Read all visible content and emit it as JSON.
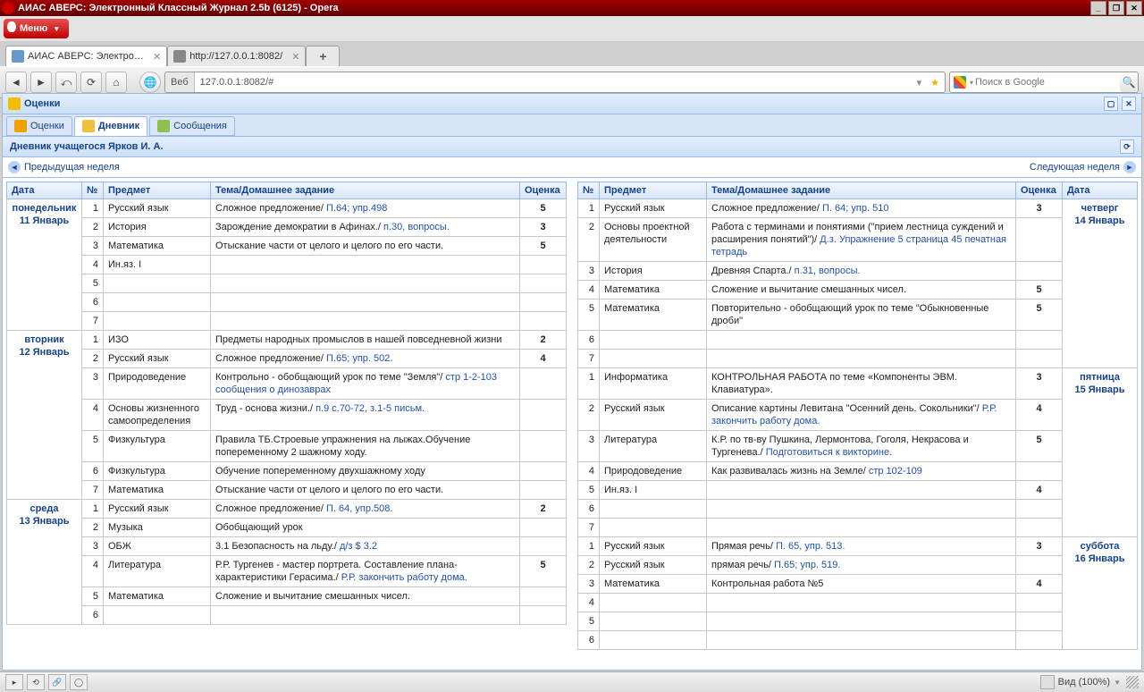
{
  "window": {
    "title": "АИАС АВЕРС: Электронный Классный Журнал 2.5b (6125) - Opera"
  },
  "opera": {
    "menu": "Меню"
  },
  "tabs": [
    {
      "label": "АИАС АВЕРС: Электрон...",
      "active": true
    },
    {
      "label": "http://127.0.0.1:8082/",
      "active": false
    }
  ],
  "nav": {
    "web_label": "Веб",
    "url": "127.0.0.1:8082/#",
    "search_placeholder": "Поиск в Google"
  },
  "panel": {
    "title": "Оценки"
  },
  "app_tabs": {
    "grades": "Оценки",
    "diary": "Дневник",
    "messages": "Сообщения"
  },
  "sub_title": "Дневник учащегося Ярков И. А.",
  "weeknav": {
    "prev": "Предыдущая неделя",
    "next": "Следующая неделя"
  },
  "headers": {
    "date": "Дата",
    "num": "№",
    "subject": "Предмет",
    "hw": "Тема/Домашнее задание",
    "mark": "Оценка"
  },
  "status": {
    "view": "Вид (100%)"
  },
  "days_left": [
    {
      "name": "понедельник",
      "date": "11 Январь",
      "rows": [
        {
          "n": 1,
          "subj": "Русский язык",
          "topic": "Сложное предложение/",
          "hw": " П.64; упр.498",
          "mark": "5"
        },
        {
          "n": 2,
          "subj": "История",
          "topic": "Зарождение демократии в Афинах./",
          "hw": " п.30, вопросы.",
          "mark": "3"
        },
        {
          "n": 3,
          "subj": "Математика",
          "topic": "Отыскание части от целого и целого по его части.",
          "hw": "",
          "mark": "5"
        },
        {
          "n": 4,
          "subj": "Ин.яз. I",
          "topic": "",
          "hw": "",
          "mark": ""
        },
        {
          "n": 5,
          "subj": "",
          "topic": "",
          "hw": "",
          "mark": ""
        },
        {
          "n": 6,
          "subj": "",
          "topic": "",
          "hw": "",
          "mark": ""
        },
        {
          "n": 7,
          "subj": "",
          "topic": "",
          "hw": "",
          "mark": ""
        }
      ]
    },
    {
      "name": "вторник",
      "date": "12 Январь",
      "rows": [
        {
          "n": 1,
          "subj": "ИЗО",
          "topic": "Предметы народных промыслов в нашей повседневной жизни",
          "hw": "",
          "mark": "2"
        },
        {
          "n": 2,
          "subj": "Русский язык",
          "topic": "Сложное предложение/",
          "hw": " П.65; упр. 502.",
          "mark": "4"
        },
        {
          "n": 3,
          "subj": "Природоведение",
          "topic": "Контрольно - обобщающий урок по теме \"Земля\"/",
          "hw": " стр 1-2-103 сообщения о динозаврах",
          "mark": ""
        },
        {
          "n": 4,
          "subj": "Основы жизненного самоопределения",
          "topic": "Труд - основа жизни./",
          "hw": " п.9 с.70-72, з.1-5 письм.",
          "mark": ""
        },
        {
          "n": 5,
          "subj": "Физкультура",
          "topic": "Правила ТБ.Строевые упражнения на лыжах.Обучение попеременному 2 шажному ходу.",
          "hw": "",
          "mark": ""
        },
        {
          "n": 6,
          "subj": "Физкультура",
          "topic": "Обучение попеременному двухшажному ходу",
          "hw": "",
          "mark": ""
        },
        {
          "n": 7,
          "subj": "Математика",
          "topic": "Отыскание части от целого и целого по его части.",
          "hw": "",
          "mark": ""
        }
      ]
    },
    {
      "name": "среда",
      "date": "13 Январь",
      "rows": [
        {
          "n": 1,
          "subj": "Русский язык",
          "topic": "Сложное предложение/",
          "hw": " П. 64, упр.508.",
          "mark": "2"
        },
        {
          "n": 2,
          "subj": "Музыка",
          "topic": "Обобщающий урок",
          "hw": "",
          "mark": ""
        },
        {
          "n": 3,
          "subj": "ОБЖ",
          "topic": "3.1 Безопасность на льду./",
          "hw": " д/з $ 3.2",
          "mark": ""
        },
        {
          "n": 4,
          "subj": "Литература",
          "topic": "Р.Р. Тургенев - мастер портрета. Составление плана-характеристики Герасима./",
          "hw": " Р.Р. закончить работу дома.",
          "mark": "5"
        },
        {
          "n": 5,
          "subj": "Математика",
          "topic": "Сложение и вычитание смешанных чисел.",
          "hw": "",
          "mark": ""
        },
        {
          "n": 6,
          "subj": "",
          "topic": "",
          "hw": "",
          "mark": ""
        }
      ]
    }
  ],
  "days_right": [
    {
      "name": "четверг",
      "date": "14 Январь",
      "rows": [
        {
          "n": 1,
          "subj": "Русский язык",
          "topic": "Сложное предложение/",
          "hw": " П. 64; упр. 510",
          "mark": "3"
        },
        {
          "n": 2,
          "subj": "Основы проектной деятельности",
          "topic": "Работа с терминами и понятиями (\"прием лестница суждений и расширения понятий\")/",
          "hw": " Д.з. Упражнение 5 страница 45 печатная тетрадь",
          "mark": ""
        },
        {
          "n": 3,
          "subj": "История",
          "topic": "Древняя Спарта./",
          "hw": " п.31, вопросы.",
          "mark": ""
        },
        {
          "n": 4,
          "subj": "Математика",
          "topic": "Сложение и вычитание смешанных чисел.",
          "hw": "",
          "mark": "5"
        },
        {
          "n": 5,
          "subj": "Математика",
          "topic": "Повторительно - обобщающий урок по теме \"Обыкновенные дроби\"",
          "hw": "",
          "mark": "5"
        },
        {
          "n": 6,
          "subj": "",
          "topic": "",
          "hw": "",
          "mark": ""
        },
        {
          "n": 7,
          "subj": "",
          "topic": "",
          "hw": "",
          "mark": ""
        }
      ]
    },
    {
      "name": "пятница",
      "date": "15 Январь",
      "rows": [
        {
          "n": 1,
          "subj": "Информатика",
          "topic": "КОНТРОЛЬНАЯ РАБОТА по теме «Компоненты ЭВМ. Клавиатура».",
          "hw": "",
          "mark": "3"
        },
        {
          "n": 2,
          "subj": "Русский язык",
          "topic": "Описание картины Левитана \"Осенний день. Сокольники\"/",
          "hw": " Р.Р. закончить работу дома.",
          "mark": "4"
        },
        {
          "n": 3,
          "subj": "Литература",
          "topic": "К.Р. по тв-ву Пушкина, Лермонтова, Гоголя, Некрасова и Тургенева./",
          "hw": " Подготовиться к викторине.",
          "mark": "5"
        },
        {
          "n": 4,
          "subj": "Природоведение",
          "topic": "Как развивалась жизнь на Земле/",
          "hw": " стр 102-109",
          "mark": ""
        },
        {
          "n": 5,
          "subj": "Ин.яз. I",
          "topic": "",
          "hw": "",
          "mark": "4"
        },
        {
          "n": 6,
          "subj": "",
          "topic": "",
          "hw": "",
          "mark": ""
        },
        {
          "n": 7,
          "subj": "",
          "topic": "",
          "hw": "",
          "mark": ""
        }
      ]
    },
    {
      "name": "суббота",
      "date": "16 Январь",
      "rows": [
        {
          "n": 1,
          "subj": "Русский язык",
          "topic": "Прямая речь/",
          "hw": " П. 65, упр. 513.",
          "mark": "3"
        },
        {
          "n": 2,
          "subj": "Русский язык",
          "topic": "прямая речь/",
          "hw": " П.65; упр. 519.",
          "mark": ""
        },
        {
          "n": 3,
          "subj": "Математика",
          "topic": "Контрольная работа №5",
          "hw": "",
          "mark": "4"
        },
        {
          "n": 4,
          "subj": "",
          "topic": "",
          "hw": "",
          "mark": ""
        },
        {
          "n": 5,
          "subj": "",
          "topic": "",
          "hw": "",
          "mark": ""
        },
        {
          "n": 6,
          "subj": "",
          "topic": "",
          "hw": "",
          "mark": ""
        }
      ]
    }
  ]
}
